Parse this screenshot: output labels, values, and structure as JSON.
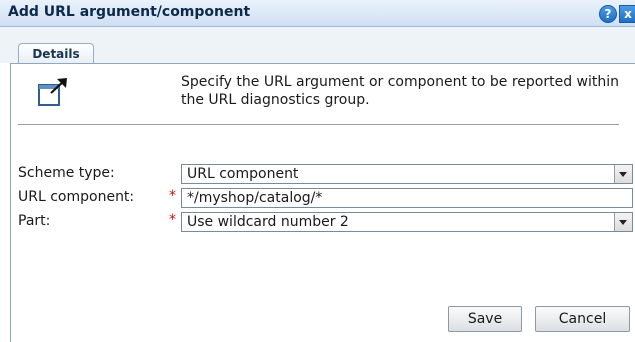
{
  "window": {
    "title": "Add URL argument/component",
    "help_glyph": "?",
    "close_glyph": "x"
  },
  "tabs": [
    {
      "label": "Details"
    }
  ],
  "description": "Specify the URL argument or component to be reported within the URL diagnostics group.",
  "icon": {
    "name": "export-arrow-icon"
  },
  "form": {
    "scheme_type": {
      "label": "Scheme type:",
      "value": "URL component"
    },
    "url_component": {
      "label": "URL component:",
      "required_mark": "*",
      "value": "*/myshop/catalog/*"
    },
    "part": {
      "label": "Part:",
      "required_mark": "*",
      "value": "Use wildcard number 2"
    }
  },
  "buttons": {
    "save": "Save",
    "cancel": "Cancel"
  },
  "colors": {
    "title_text": "#0d2a4a",
    "required": "#d01010",
    "panel_border": "#8fa6bf"
  }
}
